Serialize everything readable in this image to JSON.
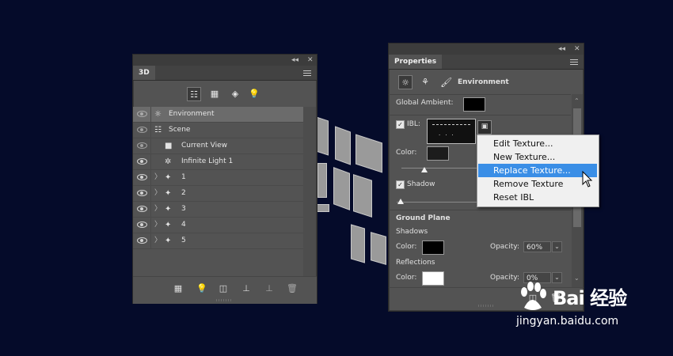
{
  "panel_3d": {
    "title": "3D",
    "rows": [
      {
        "label": "Environment",
        "icon": "environment-icon"
      },
      {
        "label": "Scene",
        "icon": "scene-icon"
      },
      {
        "label": "Current View",
        "icon": "camera-icon"
      },
      {
        "label": "Infinite Light 1",
        "icon": "infinite-light-icon"
      },
      {
        "label": "1",
        "icon": "mesh-icon"
      },
      {
        "label": "2",
        "icon": "mesh-icon"
      },
      {
        "label": "3",
        "icon": "mesh-icon"
      },
      {
        "label": "4",
        "icon": "mesh-icon"
      },
      {
        "label": "5",
        "icon": "mesh-icon"
      }
    ]
  },
  "properties": {
    "title": "Properties",
    "section_title": "Environment",
    "global_ambient_label": "Global Ambient:",
    "ibl_label": "IBL:",
    "color_label": "Color:",
    "shadow_label": "Shadow",
    "ground_plane_label": "Ground Plane",
    "shadows_label": "Shadows",
    "shadows_color_label": "Color:",
    "shadows_opacity_label": "Opacity:",
    "shadows_opacity_value": "60%",
    "reflections_label": "Reflections",
    "reflections_color_label": "Color:",
    "reflections_opacity_label": "Opacity:",
    "reflections_opacity_value": "0%"
  },
  "context_menu": {
    "items": [
      "Edit Texture...",
      "New Texture...",
      "Replace Texture...",
      "Remove Texture",
      "Reset IBL"
    ],
    "highlighted": "Replace Texture..."
  },
  "watermark": {
    "brand": "Bai 经验",
    "url": "jingyan.baidu.com"
  },
  "colors": {
    "background": "#050b2a",
    "panel": "#535353",
    "highlight": "#3a8ee6",
    "global_ambient_swatch": "#000000",
    "ibl_color_swatch": "#1c1c1c",
    "shadows_color_swatch": "#000000",
    "reflections_color_swatch": "#ffffff"
  }
}
